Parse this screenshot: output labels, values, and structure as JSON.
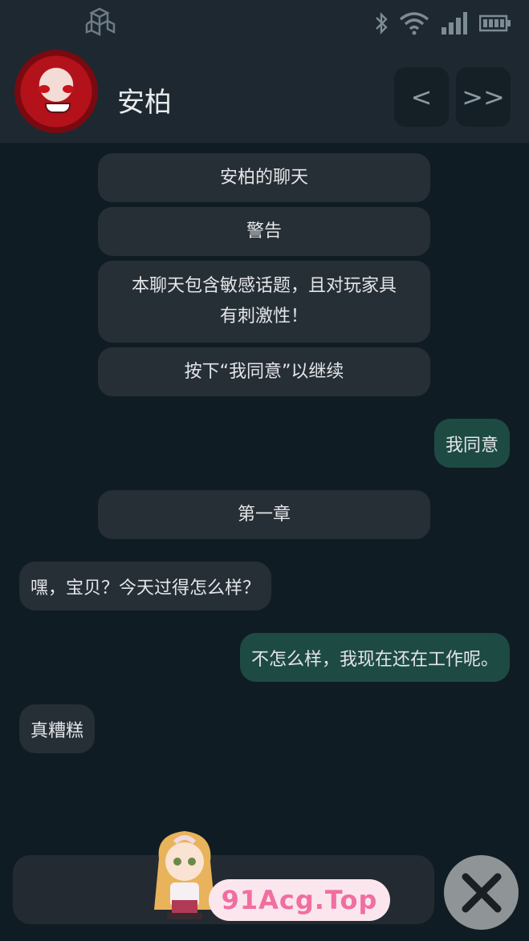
{
  "header": {
    "contact_name": "安柏",
    "prev_label": "<",
    "next_label": ">>"
  },
  "status_bar": {
    "icons": [
      "app-cube-icon",
      "bluetooth-icon",
      "wifi-icon",
      "signal-icon",
      "battery-icon"
    ]
  },
  "messages": {
    "sys_title": "安柏的聊天",
    "sys_warning": "警告",
    "sys_warning_body_1": "本聊天包含敏感话题，且对玩家具",
    "sys_warning_body_2": "有刺激性！",
    "sys_instruction": "按下“我同意”以继续",
    "user_agree": "我同意",
    "sys_chapter": "第一章",
    "in_1": "嘿，宝贝？今天过得怎么样？",
    "out_1": "不怎么样，我现在还在工作呢。",
    "in_2": "真糟糕"
  },
  "composer": {
    "close_icon": "close-icon"
  },
  "watermark": {
    "text": "91Acg.Top"
  },
  "colors": {
    "background": "#101c23",
    "header": "#1e2830",
    "incoming_bubble": "#262e36",
    "outgoing_bubble": "#1e4a44"
  }
}
